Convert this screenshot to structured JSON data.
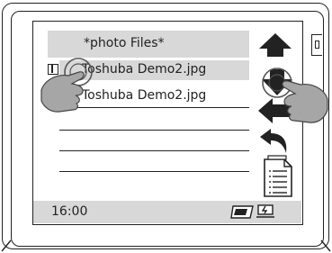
{
  "screen": {
    "title": "*photo Files*",
    "files": [
      {
        "name": "Toshuba Demo2.jpg",
        "selected": true
      },
      {
        "name": "Toshuba Demo2.jpg",
        "selected": false
      }
    ]
  },
  "status_bar": {
    "time": "16:00",
    "hdd_label": "HD"
  },
  "icons": {
    "up": "arrow-up-icon",
    "down": "arrow-down-icon",
    "left": "arrow-left-icon",
    "back": "back-curved-icon",
    "document": "document-list-icon",
    "hdd": "hdd-icon",
    "power": "power-plug-icon"
  },
  "colors": {
    "highlight": "#d8d8d8",
    "ink": "#222222",
    "hand": "#a6a6a6"
  }
}
